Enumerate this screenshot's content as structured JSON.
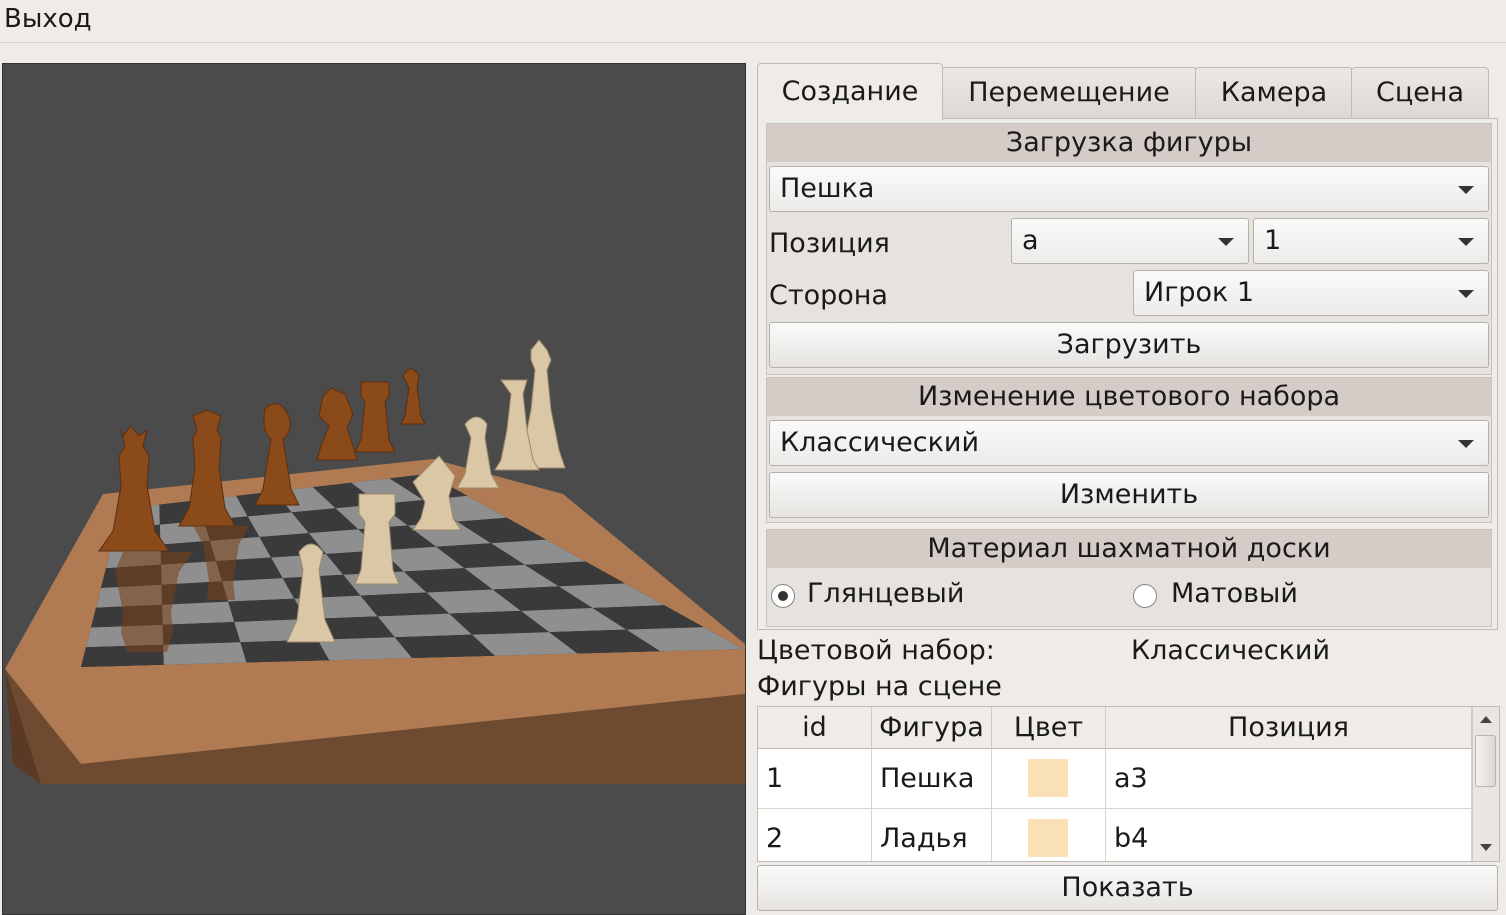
{
  "menu": {
    "exit": "Выход"
  },
  "tabs": [
    "Создание",
    "Перемещение",
    "Камера",
    "Сцена"
  ],
  "load_group": {
    "title": "Загрузка фигуры",
    "piece_select": "Пешка",
    "position_label": "Позиция",
    "file_select": "a",
    "rank_select": "1",
    "side_label": "Сторона",
    "side_select": "Игрок 1",
    "load_button": "Загрузить"
  },
  "color_group": {
    "title": "Изменение цветового набора",
    "set_select": "Классический",
    "change_button": "Изменить"
  },
  "material_group": {
    "title": "Материал шахматной доски",
    "glossy": "Глянцевый",
    "matte": "Матовый",
    "selected": "glossy"
  },
  "info": {
    "color_set_label": "Цветовой набор:",
    "color_set_value": "Классический",
    "pieces_label": "Фигуры на сцене"
  },
  "table": {
    "headers": [
      "id",
      "Фигура",
      "Цвет",
      "Позиция"
    ],
    "rows": [
      {
        "id": "1",
        "piece": "Пешка",
        "color": "#f9e0b7",
        "position": "a3"
      },
      {
        "id": "2",
        "piece": "Ладья",
        "color": "#f9e0b7",
        "position": "b4"
      }
    ]
  },
  "show_button": "Показать",
  "colors": {
    "viewport_bg": "#4b4b4b",
    "board_frame": "#b07a52",
    "dark_piece": "#8a4a1a",
    "light_piece": "#d9c7a6"
  }
}
